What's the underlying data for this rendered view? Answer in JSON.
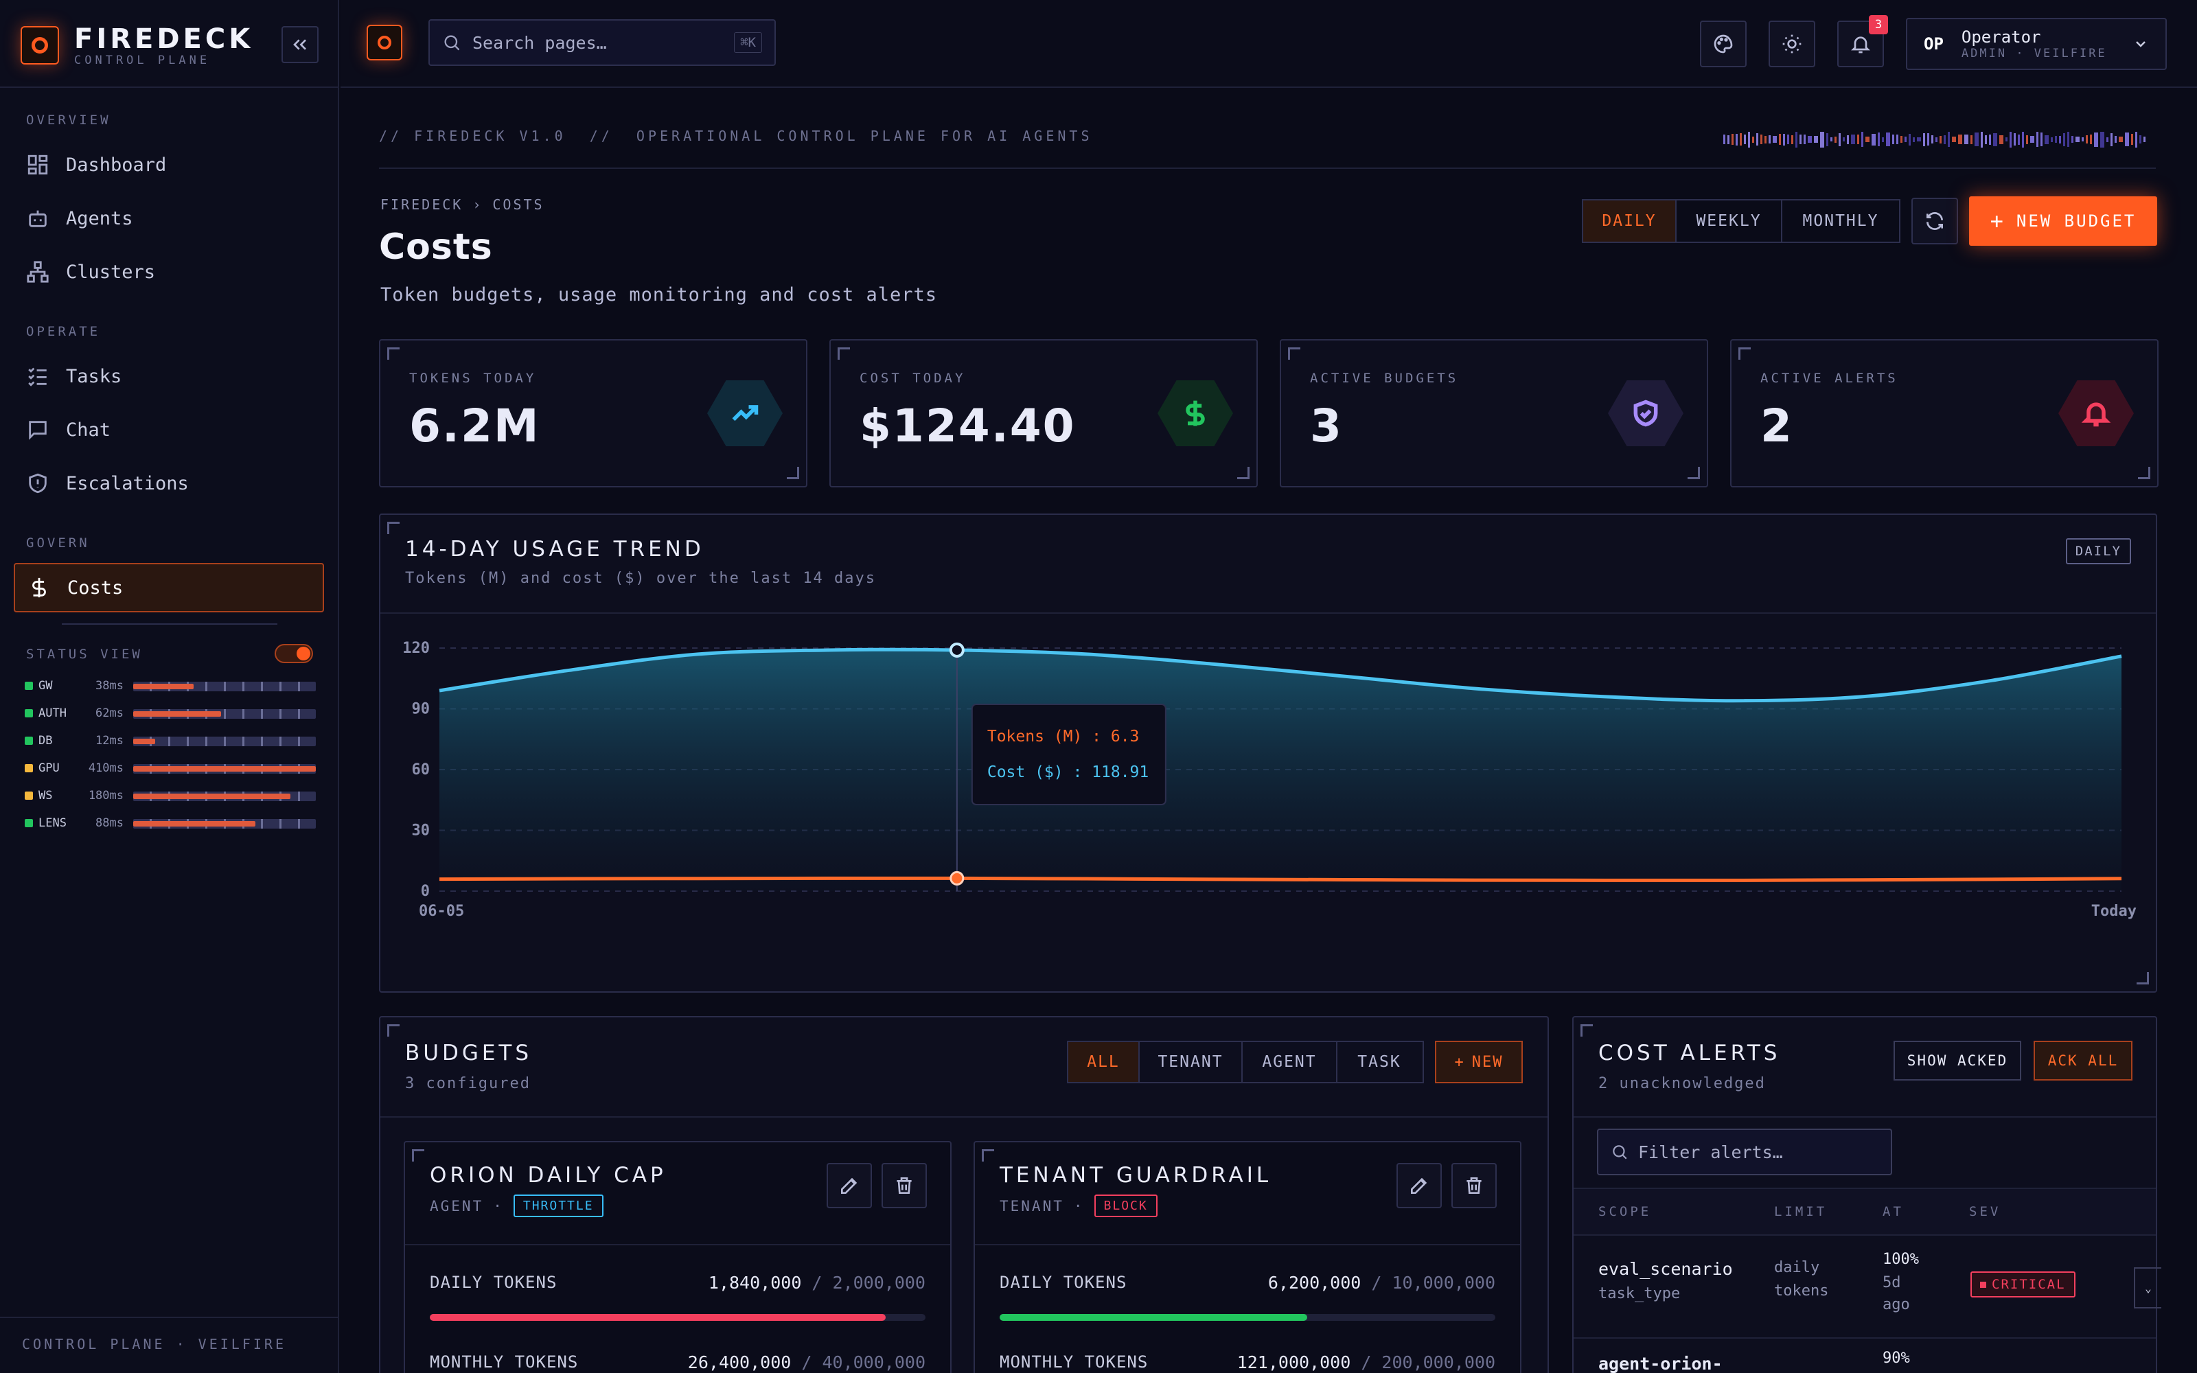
{
  "app": {
    "name": "FIREDECK",
    "subtitle": "CONTROL PLANE"
  },
  "sidebar": {
    "sections": [
      {
        "label": "OVERVIEW",
        "items": [
          {
            "label": "Dashboard",
            "icon": "dashboard-icon"
          },
          {
            "label": "Agents",
            "icon": "bot-icon"
          },
          {
            "label": "Clusters",
            "icon": "clusters-icon"
          }
        ]
      },
      {
        "label": "OPERATE",
        "items": [
          {
            "label": "Tasks",
            "icon": "tasks-icon"
          },
          {
            "label": "Chat",
            "icon": "chat-icon"
          },
          {
            "label": "Escalations",
            "icon": "shield-icon"
          }
        ]
      },
      {
        "label": "GOVERN",
        "items": [
          {
            "label": "Costs",
            "icon": "dollar-icon"
          }
        ]
      }
    ],
    "status_view_label": "STATUS VIEW",
    "services": [
      {
        "name": "GW",
        "latency": "38ms",
        "color": "#22c55e",
        "load": 0.33
      },
      {
        "name": "AUTH",
        "latency": "62ms",
        "color": "#22c55e",
        "load": 0.48
      },
      {
        "name": "DB",
        "latency": "12ms",
        "color": "#22c55e",
        "load": 0.12
      },
      {
        "name": "GPU",
        "latency": "410ms",
        "color": "#f5b83d",
        "load": 1.0
      },
      {
        "name": "WS",
        "latency": "180ms",
        "color": "#f5b83d",
        "load": 0.86
      },
      {
        "name": "LENS",
        "latency": "88ms",
        "color": "#22c55e",
        "load": 0.67
      }
    ],
    "footer": "CONTROL PLANE · VEILFIRE"
  },
  "topbar": {
    "search_placeholder": "Search pages…",
    "search_shortcut": "⌘K",
    "notification_count": "3",
    "user": {
      "initials": "OP",
      "name": "Operator",
      "role": "ADMIN · VEILFIRE"
    }
  },
  "banner": "// FIREDECK V1.0  //  OPERATIONAL CONTROL PLANE FOR AI AGENTS",
  "breadcrumb": {
    "root": "FIREDECK",
    "current": "COSTS"
  },
  "page": {
    "title": "Costs",
    "subtitle": "Token budgets, usage monitoring and cost alerts"
  },
  "period_tabs": [
    "DAILY",
    "WEEKLY",
    "MONTHLY"
  ],
  "new_budget_label": "NEW BUDGET",
  "kpis": [
    {
      "label": "TOKENS TODAY",
      "value": "6.2M",
      "icon": "trend-up-icon",
      "color": "#38bdf8"
    },
    {
      "label": "COST TODAY",
      "value": "$124.40",
      "icon": "dollar-icon",
      "color": "#22c55e"
    },
    {
      "label": "ACTIVE BUDGETS",
      "value": "3",
      "icon": "shield-check-icon",
      "color": "#a78bfa"
    },
    {
      "label": "ACTIVE ALERTS",
      "value": "2",
      "icon": "bell-icon",
      "color": "#f43f5e"
    }
  ],
  "trend": {
    "title": "14-DAY USAGE TREND",
    "subtitle": "Tokens (M) and cost ($) over the last 14 days",
    "badge": "DAILY"
  },
  "chart_data": {
    "type": "area",
    "x": [
      "06-05",
      "",
      "",
      "",
      "",
      "",
      "",
      "",
      "",
      "",
      "",
      "",
      "",
      "Today"
    ],
    "series": [
      {
        "name": "Cost ($)",
        "color": "#4cc3f0",
        "values": [
          99,
          109,
          117,
          119,
          119,
          117,
          112,
          106,
          100,
          96,
          94,
          96,
          104,
          116
        ]
      },
      {
        "name": "Tokens (M)",
        "color": "#ff6a2a",
        "values": [
          5.9,
          6.1,
          6.2,
          6.3,
          6.3,
          6.1,
          5.8,
          5.6,
          5.4,
          5.3,
          5.3,
          5.5,
          5.8,
          6.2
        ]
      }
    ],
    "yticks": [
      "0",
      "30",
      "60",
      "90",
      "120"
    ],
    "ylim": [
      0,
      120
    ],
    "tooltip": {
      "index": 4,
      "tokens_label": "Tokens (M) : 6.3",
      "cost_label": "Cost ($) : 118.91"
    }
  },
  "budgets": {
    "title": "BUDGETS",
    "subtitle": "3 configured",
    "filters": [
      "ALL",
      "TENANT",
      "AGENT",
      "TASK"
    ],
    "new_label": "NEW",
    "items": [
      {
        "name": "ORION DAILY CAP",
        "scope": "AGENT",
        "action": "THROTTLE",
        "action_color": "#38bdf8",
        "rows": [
          {
            "label": "DAILY TOKENS",
            "used": "1,840,000",
            "limit": "2,000,000",
            "fraction": 0.92,
            "color": "#f43f5e"
          },
          {
            "label": "MONTHLY TOKENS",
            "used": "26,400,000",
            "limit": "40,000,000"
          }
        ]
      },
      {
        "name": "TENANT GUARDRAIL",
        "scope": "TENANT",
        "action": "BLOCK",
        "action_color": "#f43f5e",
        "rows": [
          {
            "label": "DAILY TOKENS",
            "used": "6,200,000",
            "limit": "10,000,000",
            "fraction": 0.62,
            "color": "#22c55e"
          },
          {
            "label": "MONTHLY TOKENS",
            "used": "121,000,000",
            "limit": "200,000,000"
          }
        ]
      }
    ]
  },
  "alerts": {
    "title": "COST ALERTS",
    "subtitle": "2 unacknowledged",
    "show_acked": "SHOW ACKED",
    "ack_all": "ACK ALL",
    "filter_placeholder": "Filter alerts…",
    "columns": [
      "SCOPE",
      "LIMIT",
      "AT",
      "SEV"
    ],
    "rows": [
      {
        "scope": "eval_scenario",
        "scope_type": "task_type",
        "limit1": "daily",
        "limit2": "tokens",
        "at": "100%",
        "ago1": "5d",
        "ago2": "ago",
        "sev": "CRITICAL"
      },
      {
        "scope": "agent-orion-",
        "at": "90%"
      }
    ]
  }
}
